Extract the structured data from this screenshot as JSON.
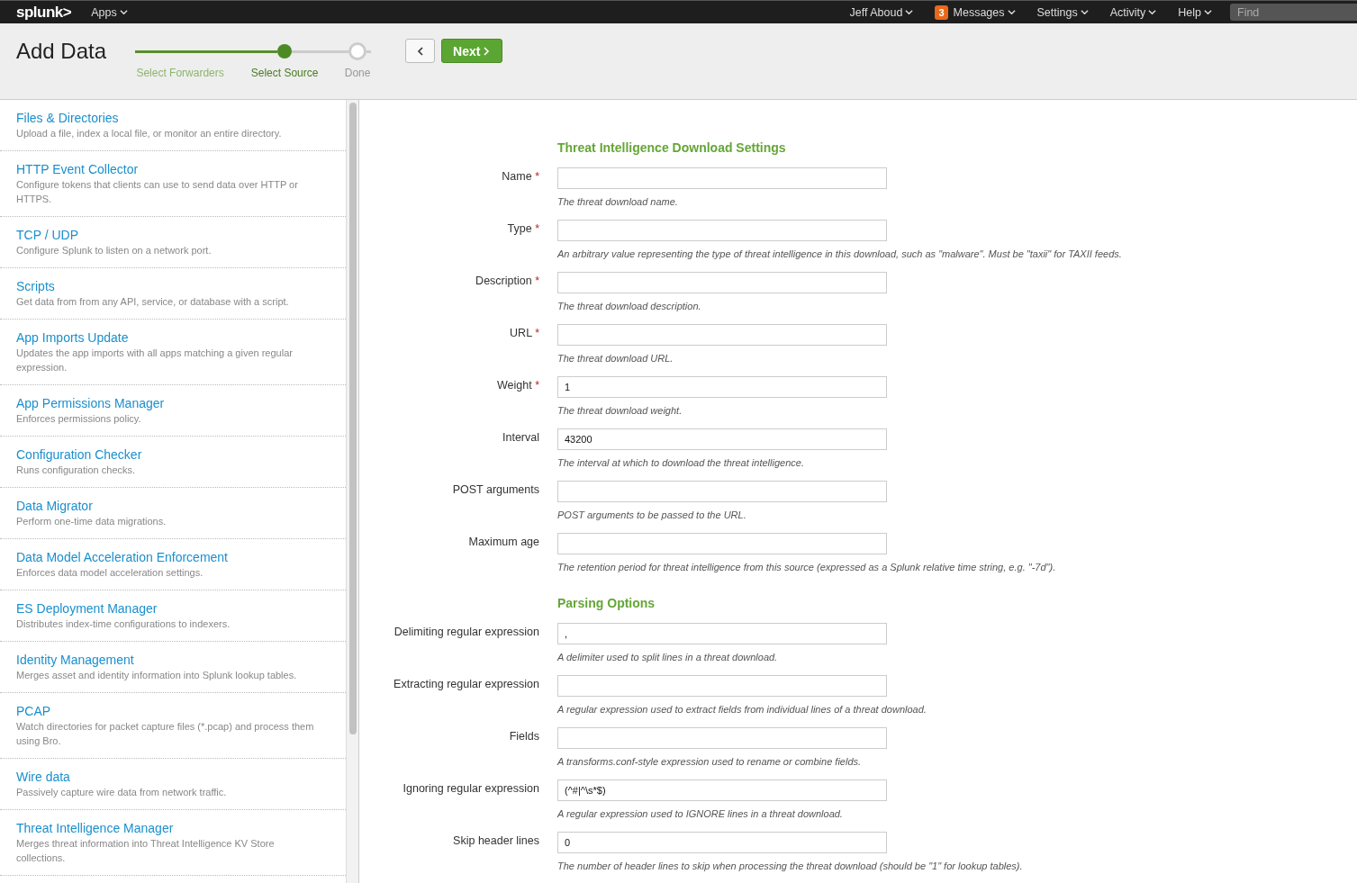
{
  "top_bar": {
    "logo": "splunk>",
    "left_menus": [
      {
        "label": "Apps"
      }
    ],
    "right_menus": [
      {
        "label": "Jeff Aboud"
      },
      {
        "label": "Messages",
        "badge": "3"
      },
      {
        "label": "Settings"
      },
      {
        "label": "Activity"
      },
      {
        "label": "Help"
      }
    ],
    "search": {
      "placeholder": "Find"
    }
  },
  "header": {
    "title": "Add Data",
    "steps": [
      {
        "label": "Select Forwarders",
        "complete": true,
        "selected": false
      },
      {
        "label": "Select Source",
        "complete": false,
        "selected": true
      },
      {
        "label": "Done",
        "complete": false,
        "selected": false
      }
    ],
    "next_button": "Next"
  },
  "sources": [
    {
      "title": "Files & Directories",
      "description": "Upload a file, index a local file, or monitor an entire directory."
    },
    {
      "title": "HTTP Event Collector",
      "description": "Configure tokens that clients can use to send data over HTTP or HTTPS."
    },
    {
      "title": "TCP / UDP",
      "description": "Configure Splunk to listen on a network port."
    },
    {
      "title": "Scripts",
      "description": "Get data from from any API, service, or database with a script."
    },
    {
      "title": "App Imports Update",
      "description": "Updates the app imports with all apps matching a given regular expression."
    },
    {
      "title": "App Permissions Manager",
      "description": "Enforces permissions policy."
    },
    {
      "title": "Configuration Checker",
      "description": "Runs configuration checks."
    },
    {
      "title": "Data Migrator",
      "description": "Perform one-time data migrations."
    },
    {
      "title": "Data Model Acceleration Enforcement",
      "description": "Enforces data model acceleration settings."
    },
    {
      "title": "ES Deployment Manager",
      "description": "Distributes index-time configurations to indexers."
    },
    {
      "title": "Identity Management",
      "description": "Merges asset and identity information into Splunk lookup tables."
    },
    {
      "title": "PCAP",
      "description": "Watch directories for packet capture files (*.pcap) and process them using Bro."
    },
    {
      "title": "Wire data",
      "description": "Passively capture wire data from network traffic."
    },
    {
      "title": "Threat Intelligence Manager",
      "description": "Merges threat information into Threat Intelligence KV Store collections."
    }
  ],
  "form_sections": [
    {
      "heading": "Threat Intelligence Download Settings",
      "fields": [
        {
          "label": "Name",
          "required_mark": "*",
          "help": "The threat download name."
        },
        {
          "label": "Type",
          "required_mark": "*",
          "help": "An arbitrary value representing the type of threat intelligence in this download, such as \"malware\". Must be \"taxii\" for TAXII feeds."
        },
        {
          "label": "Description",
          "required_mark": "*",
          "help": "The threat download description."
        },
        {
          "label": "URL",
          "required_mark": "*",
          "help": "The threat download URL."
        },
        {
          "label": "Weight",
          "required_mark": "*",
          "value": "1",
          "help": "The threat download weight."
        },
        {
          "label": "Interval",
          "value": "43200",
          "help": "The interval at which to download the threat intelligence."
        },
        {
          "label": "POST arguments",
          "help": "POST arguments to be passed to the URL."
        },
        {
          "label": "Maximum age",
          "help": "The retention period for threat intelligence from this source (expressed as a Splunk relative time string, e.g. \"-7d\")."
        }
      ]
    },
    {
      "heading": "Parsing Options",
      "fields": [
        {
          "label": "Delimiting regular expression",
          "value": ",",
          "help": "A delimiter used to split lines in a threat download."
        },
        {
          "label": "Extracting regular expression",
          "help": "A regular expression used to extract fields from individual lines of a threat download."
        },
        {
          "label": "Fields",
          "help": "A transforms.conf-style expression used to rename or combine fields."
        },
        {
          "label": "Ignoring regular expression",
          "value": "(^#|^\\s*$)",
          "help": "A regular expression used to IGNORE lines in a threat download."
        },
        {
          "label": "Skip header lines",
          "value": "0",
          "help": "The number of header lines to skip when processing the threat download (should be \"1\" for lookup tables)."
        }
      ]
    }
  ]
}
